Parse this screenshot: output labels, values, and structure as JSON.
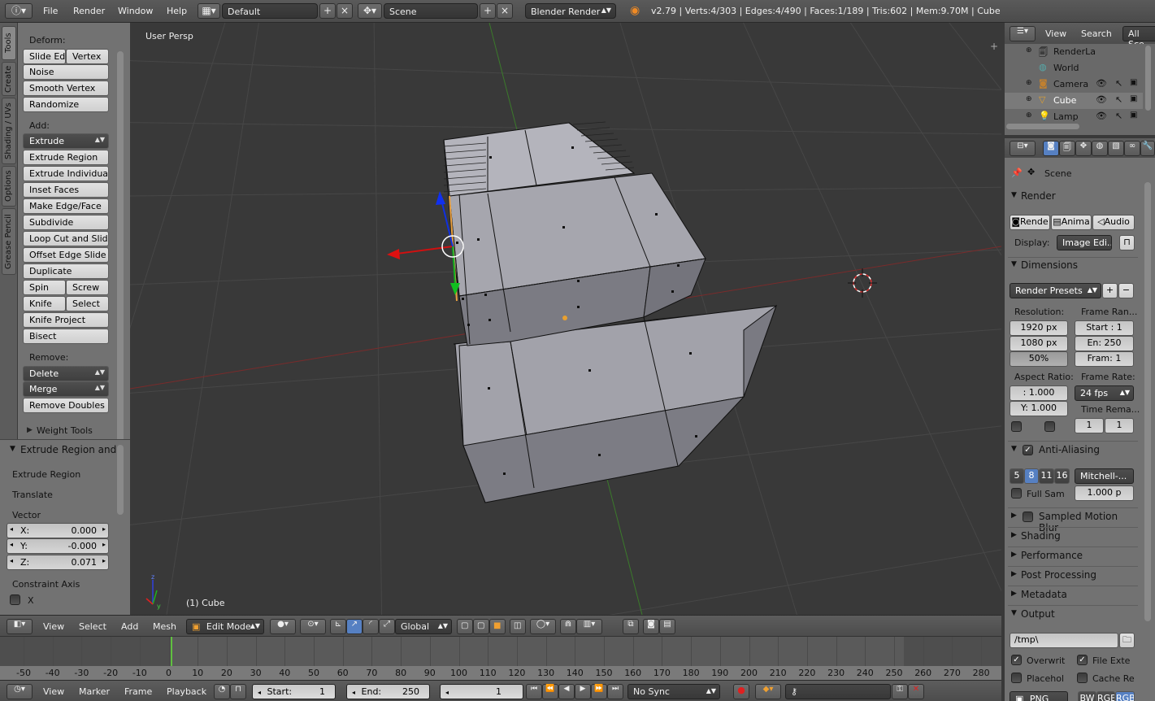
{
  "topbar": {
    "menus": [
      "File",
      "Render",
      "Window",
      "Help"
    ],
    "layout": "Default",
    "scene": "Scene",
    "engine": "Blender Render",
    "stats": "v2.79 | Verts:4/303 | Edges:4/490 | Faces:1/189 | Tris:602 | Mem:9.70M | Cube"
  },
  "lefttabs": [
    "Tools",
    "Create",
    "Shading / UVs",
    "Options",
    "Grease Pencil"
  ],
  "toolshelf": {
    "deform_label": "Deform:",
    "slide_edge": "Slide Ed",
    "vertex": "Vertex",
    "noise": "Noise",
    "smooth_vertex": "Smooth Vertex",
    "randomize": "Randomize",
    "add_label": "Add:",
    "extrude": "Extrude",
    "extrude_region": "Extrude Region",
    "extrude_individual": "Extrude Individual",
    "inset_faces": "Inset Faces",
    "make_edge_face": "Make Edge/Face",
    "subdivide": "Subdivide",
    "loop_cut_slide": "Loop Cut and Slide",
    "offset_edge_slide": "Offset Edge Slide",
    "duplicate": "Duplicate",
    "spin": "Spin",
    "screw": "Screw",
    "knife": "Knife",
    "select": "Select",
    "knife_project": "Knife Project",
    "bisect": "Bisect",
    "remove_label": "Remove:",
    "delete": "Delete",
    "merge": "Merge",
    "remove_doubles": "Remove Doubles",
    "weight_tools": "Weight Tools"
  },
  "operator": {
    "title": "Extrude Region and",
    "extrude_region": "Extrude Region",
    "translate": "Translate",
    "vector_label": "Vector",
    "x_label": "X:",
    "x_value": "0.000",
    "y_label": "Y:",
    "y_value": "-0.000",
    "z_label": "Z:",
    "z_value": "0.071",
    "constraint_label": "Constraint Axis",
    "cx": "X"
  },
  "viewport": {
    "view_name": "User Persp",
    "object_label": "(1) Cube"
  },
  "view3d_header": {
    "menus": [
      "View",
      "Select",
      "Add",
      "Mesh"
    ],
    "mode": "Edit Mode",
    "orientation": "Global"
  },
  "timeline": {
    "ticks": [
      "-50",
      "-40",
      "-30",
      "-20",
      "-10",
      "0",
      "10",
      "20",
      "30",
      "40",
      "50",
      "60",
      "70",
      "80",
      "90",
      "100",
      "110",
      "120",
      "130",
      "140",
      "150",
      "160",
      "170",
      "180",
      "190",
      "200",
      "210",
      "220",
      "230",
      "240",
      "250",
      "260",
      "270",
      "280"
    ],
    "menus": [
      "View",
      "Marker",
      "Frame",
      "Playback"
    ],
    "start_label": "Start:",
    "start_value": "1",
    "end_label": "End:",
    "end_value": "250",
    "current": "1",
    "sync": "No Sync"
  },
  "outliner": {
    "menus": [
      "View",
      "Search"
    ],
    "filter": "All Sce",
    "items": [
      "RenderLa",
      "World",
      "Camera",
      "Cube",
      "Lamp"
    ]
  },
  "properties": {
    "context": "Scene",
    "render": {
      "title": "Render",
      "render_btn": "Rende",
      "anim_btn": "Anima",
      "audio_btn": "Audio",
      "display_label": "Display:",
      "display_value": "Image Edi..."
    },
    "dimensions": {
      "title": "Dimensions",
      "presets": "Render Presets",
      "resolution_label": "Resolution:",
      "res_x": "1920 px",
      "res_y": "1080 px",
      "res_pct": "50%",
      "frame_range_label": "Frame Ran...",
      "start": "Start : 1",
      "end": "En: 250",
      "frame": "Fram: 1",
      "aspect_label": "Aspect Ratio:",
      "aspect_x": ": 1.000",
      "aspect_y": "Y: 1.000",
      "frame_rate_label": "Frame Rate:",
      "fps": "24 fps",
      "time_remap_label": "Time Rema...",
      "remap_old": "1",
      "remap_new": "1"
    },
    "antialiasing": {
      "title": "Anti-Aliasing",
      "samples": [
        "5",
        "8",
        "11",
        "16"
      ],
      "filter": "Mitchell-...",
      "full_sample": "Full Sam",
      "filter_size": "1.000 p"
    },
    "panels": [
      "Sampled Motion Blur",
      "Shading",
      "Performance",
      "Post Processing",
      "Metadata"
    ],
    "output": {
      "title": "Output",
      "path": "/tmp\\",
      "overwrite": "Overwrit",
      "file_ext": "File Exte",
      "placeholders": "Placehol",
      "cache_result": "Cache Re",
      "format": "PNG",
      "bw": "BW",
      "rgb": "RGB",
      "rgba": "RGB"
    }
  },
  "colors": {
    "accent_blue": "#5680c2",
    "mesh_face": "#9a9aa4",
    "grid_line": "#474747",
    "axis_x": "#8a2a2a",
    "axis_y": "#3c8a2c"
  }
}
